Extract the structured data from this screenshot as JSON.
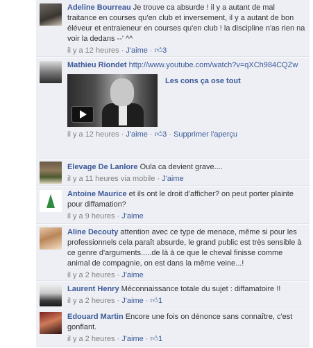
{
  "comments": [
    {
      "author": "Adeline Bourreau",
      "text": "Je trouve ca absurde ! il y a autant de mal traitance en courses qu'en club et inversement, il y a autant de bon éléveur et entraieneur en courses qu'en club ! la discipline n'as rien na voir la dedans --' ^^",
      "time": "il y a 12 heures",
      "like": "J'aime",
      "likes": "3"
    },
    {
      "author": "Mathieu Riondet",
      "text": "http://www.youtube.com/watch?v=qXCh984CQZw",
      "video_title": "Les cons ça ose tout",
      "time": "il y a 12 heures",
      "like": "J'aime",
      "likes": "3",
      "extra_link": "Supprimer l'aperçu"
    },
    {
      "author": "Elevage De Lanlore",
      "text": "Oula ca devient grave....",
      "time": "il y a 11 heures via mobile",
      "like": "J'aime"
    },
    {
      "author": "Antoine Maurice",
      "text": "et ils ont le droit d'afficher? on peut porter plainte pour diffamation?",
      "time": "il y a 9 heures",
      "like": "J'aime"
    },
    {
      "author": "Aline Decouty",
      "text": "attention avec ce type de menace, même si pour les professionnels cela paraît absurde, le grand public est très sensible à ce genre d'arguments.....de là à ce que le cheval finisse comme animal de compagnie, on est dans la même veine...!",
      "time": "il y a 2 heures",
      "like": "J'aime"
    },
    {
      "author": "Laurent Henry",
      "text": "Méconnaissance totale du sujet : diffamatoire !!",
      "time": "il y a 2 heures",
      "like": "J'aime",
      "likes": "1"
    },
    {
      "author": "Edouard Martin",
      "text": "Encore une fois on dénonce sans connaître, c'est gonflant.",
      "time": "il y a 2 heures",
      "like": "J'aime",
      "likes": "1"
    }
  ],
  "separator": "·",
  "like_icon": "thumbs-up-icon",
  "colors": {
    "link": "#3b5998",
    "bg": "#edeff4",
    "meta": "#808080"
  }
}
